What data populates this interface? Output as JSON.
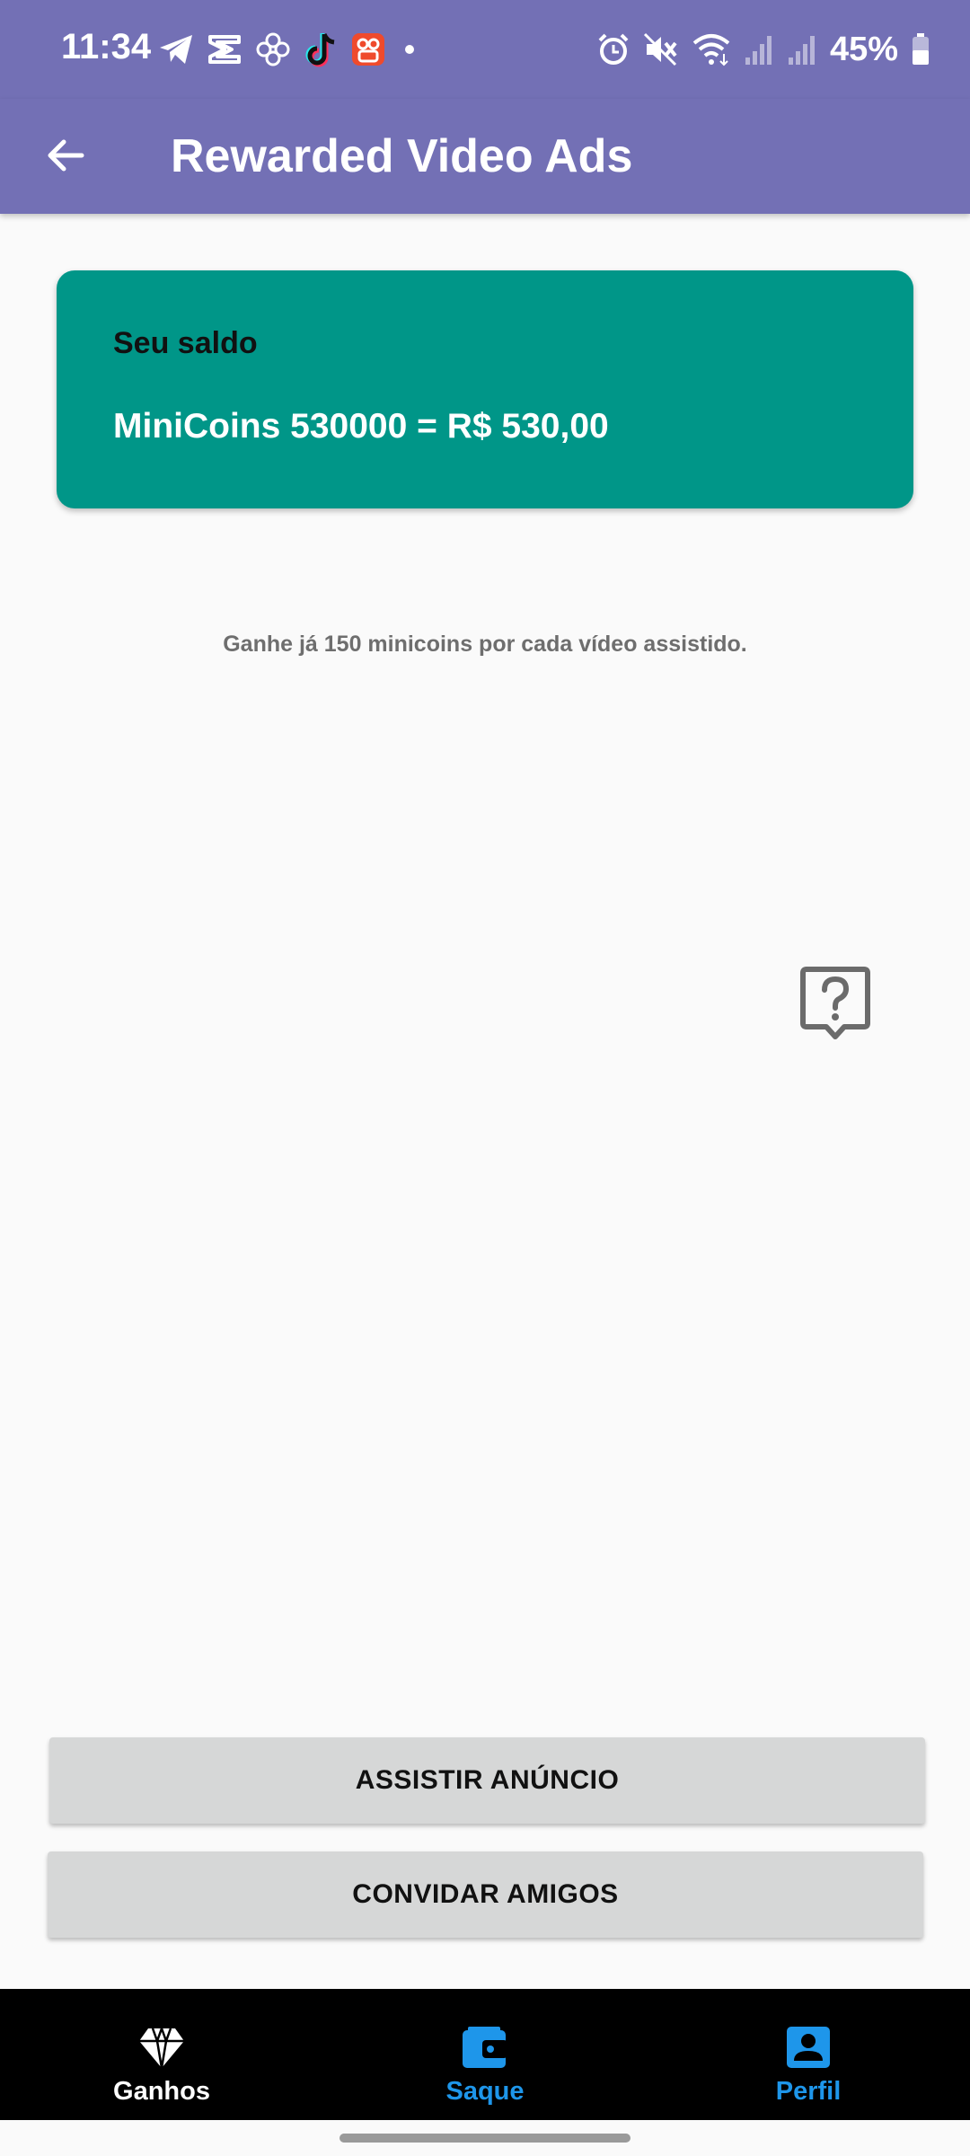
{
  "status": {
    "time": "11:34",
    "battery": "45%",
    "left_icons": [
      "telegram-icon",
      "capcut-icon",
      "flower-icon",
      "tiktok-icon",
      "kwai-icon",
      "dot-icon"
    ],
    "right_icons": [
      "alarm-icon",
      "mute-icon",
      "wifi-icon",
      "signal-icon",
      "signal-icon",
      "battery-icon"
    ]
  },
  "appbar": {
    "title": "Rewarded Video Ads",
    "back_icon": "arrow-back-icon"
  },
  "balance": {
    "label": "Seu saldo",
    "value": "MiniCoins 530000 = R$ 530,00"
  },
  "info": {
    "text": "Ganhe já 150 minicoins por cada vídeo assistido."
  },
  "actions": {
    "watch_label": "ASSISTIR ANÚNCIO",
    "invite_label": "CONVIDAR AMIGOS"
  },
  "nav": {
    "items": [
      {
        "label": "Ganhos",
        "icon": "diamond-icon",
        "active": true
      },
      {
        "label": "Saque",
        "icon": "wallet-icon",
        "active": false
      },
      {
        "label": "Perfil",
        "icon": "profile-icon",
        "active": false
      }
    ]
  },
  "colors": {
    "appbar": "#7370b5",
    "card": "#009688",
    "nav_inactive": "#1e96ea",
    "nav_background": "#000000"
  }
}
